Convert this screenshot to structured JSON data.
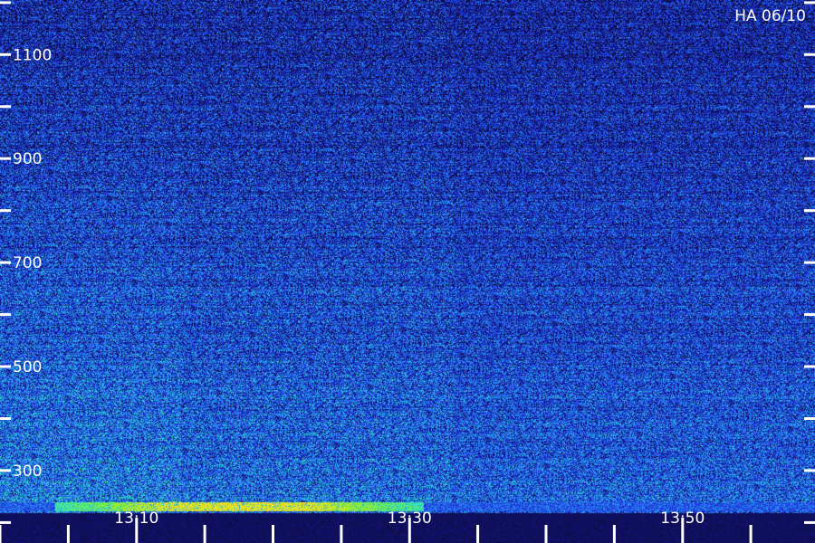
{
  "chart_data": {
    "type": "heatmap",
    "title": "HA 06/10",
    "xlabel": "",
    "ylabel": "",
    "x_tick_labels": [
      "13:10",
      "13:30",
      "13:50"
    ],
    "x_ticks_minutes_after_13h": [
      10,
      30,
      50
    ],
    "x_minor_tick_interval_minutes": 5,
    "y_tick_labels": [
      "300",
      "500",
      "700",
      "900",
      "1100"
    ],
    "y_ticks": [
      300,
      500,
      700,
      900,
      1100
    ],
    "y_minor_ticks": [
      200,
      400,
      600,
      800,
      1000,
      1200
    ],
    "ylim": [
      225,
      1205
    ],
    "x_range_minutes_after_13h": [
      0,
      59.7
    ],
    "grid": false,
    "colormap": [
      "#0a0a30",
      "#1a1ab0",
      "#2250f0",
      "#2aa0f0",
      "#30e0c0",
      "#70f040",
      "#f0e020"
    ],
    "features": [
      {
        "label": "strong low-frequency band",
        "freq_range": [
          225,
          240
        ],
        "time_minutes_after_13h": [
          4,
          31
        ],
        "intensity": "high"
      }
    ]
  }
}
